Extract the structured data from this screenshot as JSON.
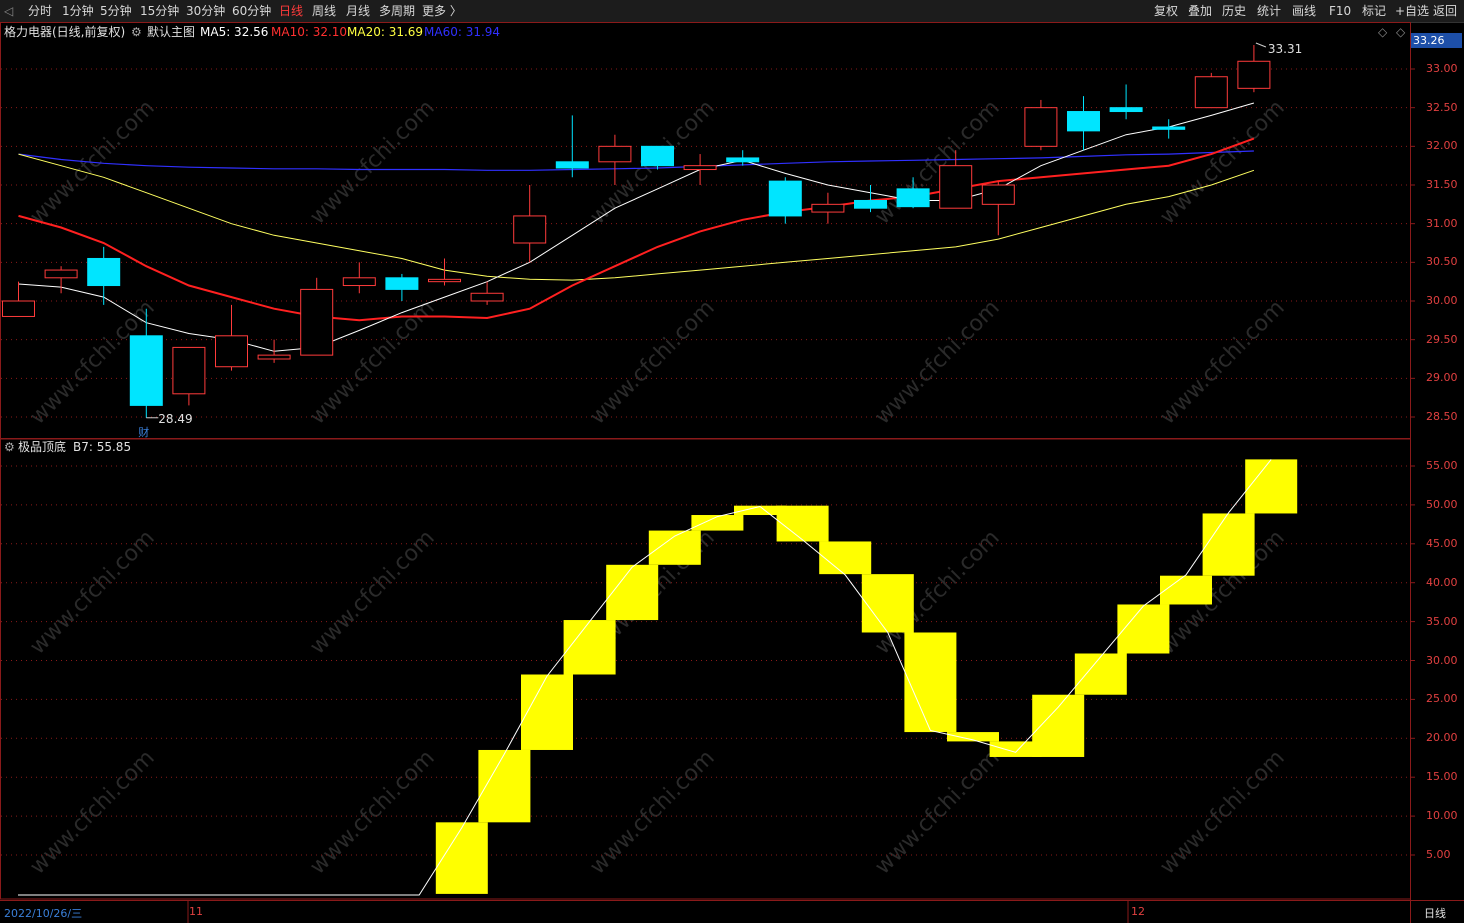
{
  "toolbar": {
    "left_tabs": [
      "分时",
      "1分钟",
      "5分钟",
      "15分钟",
      "30分钟",
      "60分钟",
      "日线",
      "周线",
      "月线",
      "多周期",
      "更多 〉"
    ],
    "active_tab": "日线",
    "right_buttons": [
      "复权",
      "叠加",
      "历史",
      "统计",
      "画线",
      "F10",
      "标记",
      "+自选",
      "返回"
    ]
  },
  "main_header": {
    "stock": "格力电器(日线,前复权)",
    "indicator_name": "默认主图",
    "ma5": "MA5: 32.56",
    "ma10": "MA10: 32.10",
    "ma20": "MA20: 31.69",
    "ma60": "MA60: 31.94",
    "price_tag": "33.26",
    "high_label": "33.31",
    "low_label": "28.49",
    "event_marker": "财"
  },
  "sub_header": {
    "indicator_name": "极品顶底",
    "value": "B7: 55.85"
  },
  "bottom_bar": {
    "date": "2022/10/26/三",
    "month_11": "11",
    "month_12": "12",
    "period": "日线"
  },
  "watermark": "www.cfchi.com",
  "colors": {
    "up": "#ff3b3b",
    "down": "#00e5ff",
    "ma5": "#ffffff",
    "ma10": "#ff2020",
    "ma20": "#ffff60",
    "ma60": "#3030ff",
    "indicator": "#ffff00",
    "grid": "#8a1a1a"
  },
  "chart_data": [
    {
      "type": "candlestick",
      "title": "格力电器(日线,前复权)",
      "ylim": [
        28.2,
        33.5
      ],
      "yticks": [
        "33.00",
        "32.50",
        "32.00",
        "31.50",
        "31.00",
        "30.50",
        "30.00",
        "29.50",
        "29.00",
        "28.50"
      ],
      "candles": [
        {
          "o": 29.8,
          "h": 30.25,
          "l": 29.8,
          "c": 30.0
        },
        {
          "o": 30.3,
          "h": 30.45,
          "l": 30.1,
          "c": 30.4
        },
        {
          "o": 30.55,
          "h": 30.7,
          "l": 29.95,
          "c": 30.2
        },
        {
          "o": 29.55,
          "h": 29.9,
          "l": 28.49,
          "c": 28.65
        },
        {
          "o": 28.8,
          "h": 29.4,
          "l": 28.65,
          "c": 29.4
        },
        {
          "o": 29.15,
          "h": 29.95,
          "l": 29.1,
          "c": 29.55
        },
        {
          "o": 29.25,
          "h": 29.5,
          "l": 29.2,
          "c": 29.3
        },
        {
          "o": 29.3,
          "h": 30.3,
          "l": 29.3,
          "c": 30.15
        },
        {
          "o": 30.2,
          "h": 30.5,
          "l": 30.1,
          "c": 30.3
        },
        {
          "o": 30.3,
          "h": 30.35,
          "l": 30.0,
          "c": 30.15
        },
        {
          "o": 30.25,
          "h": 30.55,
          "l": 30.2,
          "c": 30.28
        },
        {
          "o": 30.0,
          "h": 30.25,
          "l": 29.95,
          "c": 30.1
        },
        {
          "o": 30.75,
          "h": 31.5,
          "l": 30.5,
          "c": 31.1
        },
        {
          "o": 31.8,
          "h": 32.4,
          "l": 31.6,
          "c": 31.72
        },
        {
          "o": 31.8,
          "h": 32.15,
          "l": 31.5,
          "c": 32.0
        },
        {
          "o": 32.0,
          "h": 32.0,
          "l": 31.7,
          "c": 31.75
        },
        {
          "o": 31.7,
          "h": 31.9,
          "l": 31.5,
          "c": 31.75
        },
        {
          "o": 31.85,
          "h": 31.95,
          "l": 31.75,
          "c": 31.8
        },
        {
          "o": 31.55,
          "h": 31.6,
          "l": 31.0,
          "c": 31.1
        },
        {
          "o": 31.15,
          "h": 31.4,
          "l": 31.0,
          "c": 31.25
        },
        {
          "o": 31.3,
          "h": 31.5,
          "l": 31.15,
          "c": 31.2
        },
        {
          "o": 31.45,
          "h": 31.6,
          "l": 31.2,
          "c": 31.22
        },
        {
          "o": 31.2,
          "h": 31.95,
          "l": 31.2,
          "c": 31.75
        },
        {
          "o": 31.25,
          "h": 31.55,
          "l": 30.85,
          "c": 31.5
        },
        {
          "o": 32.0,
          "h": 32.6,
          "l": 31.95,
          "c": 32.5
        },
        {
          "o": 32.45,
          "h": 32.65,
          "l": 31.95,
          "c": 32.2
        },
        {
          "o": 32.5,
          "h": 32.8,
          "l": 32.35,
          "c": 32.45
        },
        {
          "o": 32.25,
          "h": 32.35,
          "l": 32.1,
          "c": 32.22
        },
        {
          "o": 32.5,
          "h": 32.95,
          "l": 32.5,
          "c": 32.9
        },
        {
          "o": 32.75,
          "h": 33.31,
          "l": 32.7,
          "c": 33.1
        }
      ],
      "ma5": [
        30.22,
        30.18,
        30.05,
        29.72,
        29.58,
        29.5,
        29.35,
        29.4,
        29.62,
        29.85,
        30.05,
        30.25,
        30.5,
        30.85,
        31.2,
        31.45,
        31.7,
        31.82,
        31.65,
        31.5,
        31.4,
        31.3,
        31.3,
        31.45,
        31.75,
        31.95,
        32.15,
        32.25,
        32.4,
        32.56
      ],
      "ma10": [
        31.1,
        30.95,
        30.75,
        30.45,
        30.2,
        30.05,
        29.9,
        29.8,
        29.75,
        29.8,
        29.8,
        29.78,
        29.9,
        30.2,
        30.45,
        30.7,
        30.9,
        31.05,
        31.15,
        31.22,
        31.3,
        31.35,
        31.45,
        31.55,
        31.6,
        31.65,
        31.7,
        31.75,
        31.9,
        32.1
      ],
      "ma20": [
        31.9,
        31.75,
        31.6,
        31.4,
        31.2,
        31.0,
        30.85,
        30.75,
        30.65,
        30.55,
        30.4,
        30.32,
        30.28,
        30.27,
        30.3,
        30.35,
        30.4,
        30.45,
        30.5,
        30.55,
        30.6,
        30.65,
        30.7,
        30.8,
        30.95,
        31.1,
        31.25,
        31.35,
        31.5,
        31.69
      ],
      "ma60": [
        31.9,
        31.83,
        31.78,
        31.75,
        31.73,
        31.72,
        31.71,
        31.71,
        31.7,
        31.7,
        31.7,
        31.69,
        31.69,
        31.7,
        31.71,
        31.72,
        31.74,
        31.76,
        31.78,
        31.8,
        31.81,
        31.82,
        31.83,
        31.84,
        31.85,
        31.87,
        31.89,
        31.9,
        31.92,
        31.94
      ]
    },
    {
      "type": "bar",
      "title": "极品顶底",
      "ylim": [
        0,
        57
      ],
      "yticks": [
        "55.00",
        "50.00",
        "45.00",
        "40.00",
        "35.00",
        "30.00",
        "25.00",
        "20.00",
        "15.00",
        "10.00",
        "5.00"
      ],
      "bars": [
        {
          "lo": 0,
          "hi": 0
        },
        {
          "lo": 0,
          "hi": 0
        },
        {
          "lo": 0,
          "hi": 0
        },
        {
          "lo": 0,
          "hi": 0
        },
        {
          "lo": 0,
          "hi": 0
        },
        {
          "lo": 0,
          "hi": 0
        },
        {
          "lo": 0,
          "hi": 0
        },
        {
          "lo": 0,
          "hi": 0
        },
        {
          "lo": 0,
          "hi": 0
        },
        {
          "lo": 0,
          "hi": 0
        },
        {
          "lo": 0,
          "hi": 9.2
        },
        {
          "lo": 9.2,
          "hi": 18.5
        },
        {
          "lo": 18.5,
          "hi": 28.2
        },
        {
          "lo": 28.2,
          "hi": 35.2
        },
        {
          "lo": 35.2,
          "hi": 42.3
        },
        {
          "lo": 42.3,
          "hi": 46.7
        },
        {
          "lo": 46.7,
          "hi": 48.7
        },
        {
          "lo": 48.7,
          "hi": 49.9
        },
        {
          "lo": 45.3,
          "hi": 49.9
        },
        {
          "lo": 41.1,
          "hi": 45.3
        },
        {
          "lo": 33.6,
          "hi": 41.1
        },
        {
          "lo": 20.8,
          "hi": 33.6
        },
        {
          "lo": 19.6,
          "hi": 20.8
        },
        {
          "lo": 17.6,
          "hi": 19.6
        },
        {
          "lo": 17.6,
          "hi": 25.6
        },
        {
          "lo": 25.6,
          "hi": 30.9
        },
        {
          "lo": 30.9,
          "hi": 37.2
        },
        {
          "lo": 37.2,
          "hi": 40.9
        },
        {
          "lo": 40.9,
          "hi": 48.9
        },
        {
          "lo": 48.9,
          "hi": 55.85
        }
      ],
      "line": [
        0,
        0,
        0,
        0,
        0,
        0,
        0,
        0,
        0,
        0,
        8.5,
        18.0,
        28.0,
        35.0,
        42.0,
        46.0,
        48.5,
        49.8,
        45.5,
        41.0,
        33.6,
        21.0,
        19.8,
        18.2,
        24.0,
        30.5,
        37.0,
        41.0,
        49.0,
        55.85
      ]
    }
  ]
}
